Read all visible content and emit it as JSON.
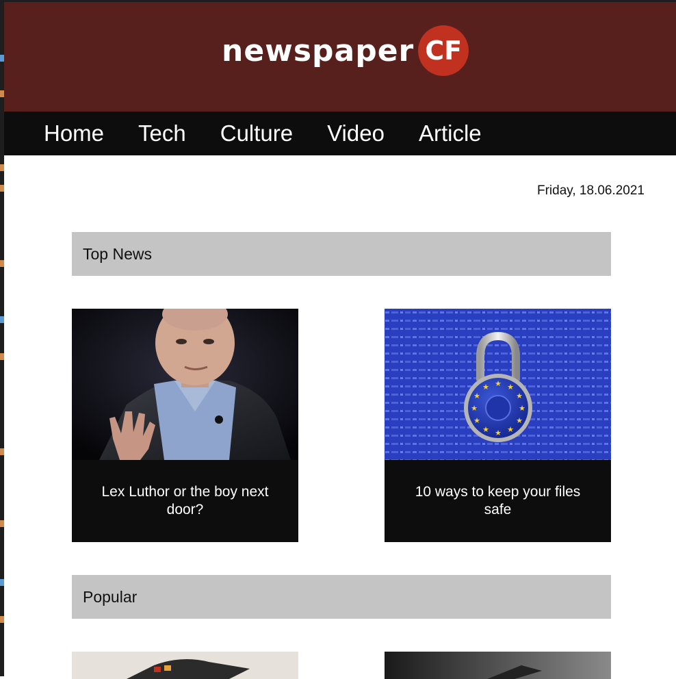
{
  "masthead": {
    "logo_text": "newspaper",
    "logo_badge": "CF"
  },
  "nav": {
    "items": [
      "Home",
      "Tech",
      "Culture",
      "Video",
      "Article"
    ]
  },
  "date": "Friday, 18.06.2021",
  "sections": {
    "top_news": {
      "title": "Top News",
      "cards": [
        {
          "title": "Lex Luthor or the boy next door?"
        },
        {
          "title": "10 ways to keep your files safe"
        }
      ]
    },
    "popular": {
      "title": "Popular"
    }
  },
  "colors": {
    "masthead_bg": "#57201d",
    "badge": "#c0311f",
    "nav_bg": "#0d0d0d",
    "section_bar": "#c4c4c4",
    "card_caption_bg": "#0d0d0d"
  }
}
